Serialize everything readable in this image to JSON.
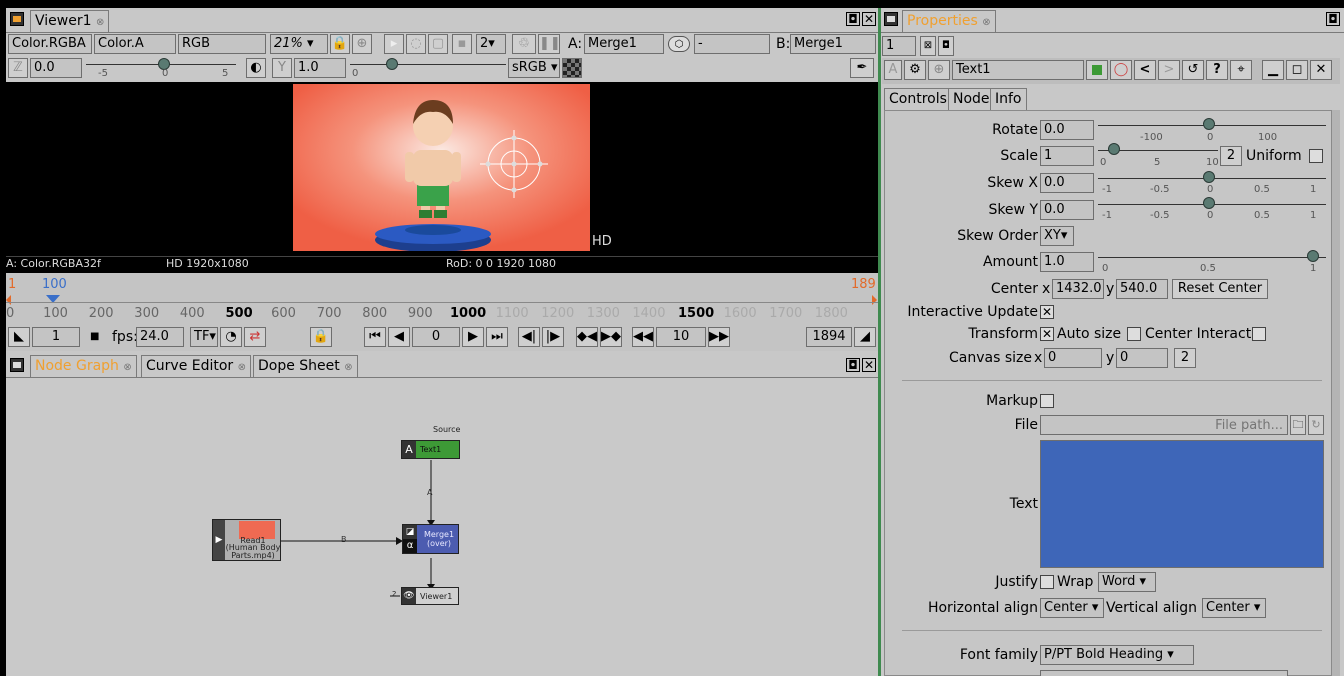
{
  "viewer": {
    "tab": "Viewer1",
    "layer": "Color.RGBA",
    "alpha": "Color.A",
    "channels": "RGB",
    "zoom": "21%",
    "proxy": "2",
    "a_label": "A:",
    "a_input": "Merge1",
    "wipe": "-",
    "b_label": "B:",
    "b_input": "Merge1",
    "gain": "0.0",
    "gamma": "1.0",
    "colorspace": "sRGB",
    "gain_ticks": [
      "-5",
      "0",
      "5"
    ],
    "gamma_ticks": [
      "0"
    ],
    "format_badge": "HD",
    "info_left": "A: Color.RGBA32f",
    "info_mid": "HD 1920x1080",
    "info_right": "RoD: 0 0 1920 1080"
  },
  "timeline": {
    "first_marker": "1",
    "current_marker": "100",
    "last_marker": "189",
    "ruler": [
      "0",
      "100",
      "200",
      "300",
      "400",
      "500",
      "600",
      "700",
      "800",
      "900",
      "1000",
      "1100",
      "1200",
      "1300",
      "1400",
      "1500",
      "1600",
      "1700",
      "1800"
    ],
    "start": "1",
    "fps_label": "fps:",
    "fps": "24.0",
    "tf": "TF",
    "frame": "0",
    "increment": "10",
    "end": "1894"
  },
  "nodegraph": {
    "tabs": [
      "Node Graph",
      "Curve Editor",
      "Dope Sheet"
    ],
    "text_node": {
      "label": "Text1",
      "source": "Source",
      "input": "A"
    },
    "read_node": {
      "label": "Read1",
      "sub": "(Human Body Parts.mp4)"
    },
    "merge_node": {
      "label": "Merge1",
      "sub": "(over)"
    },
    "viewer_node": {
      "label": "Viewer1",
      "idx": "2"
    },
    "edge_a": "A",
    "edge_b": "B"
  },
  "properties": {
    "tab": "Properties",
    "max_panels": "1",
    "node_name": "Text1",
    "subtabs": [
      "Controls",
      "Node",
      "Info"
    ],
    "rotate_label": "Rotate",
    "rotate": "0.0",
    "rotate_ticks": [
      "-100",
      "0",
      "100"
    ],
    "scale_label": "Scale",
    "scale": "1",
    "scale_ticks": [
      "0",
      "5",
      "10"
    ],
    "scale_dim": "2",
    "uniform": "Uniform",
    "skewx_label": "Skew X",
    "skewx": "0.0",
    "skewy_label": "Skew Y",
    "skewy": "0.0",
    "skew_ticks": [
      "-1",
      "-0.5",
      "0",
      "0.5",
      "1"
    ],
    "skew_order_label": "Skew Order",
    "skew_order": "XY",
    "amount_label": "Amount",
    "amount": "1.0",
    "amount_ticks": [
      "0",
      "0.5",
      "1"
    ],
    "center_label": "Center",
    "center_x_label": "x",
    "center_x": "1432.0",
    "center_y_label": "y",
    "center_y": "540.0",
    "reset_center": "Reset Center",
    "interactive_update": "Interactive Update",
    "transform": "Transform",
    "auto_size": "Auto size",
    "center_interact": "Center Interact",
    "canvas_label": "Canvas size",
    "canvas_x_label": "x",
    "canvas_x": "0",
    "canvas_y_label": "y",
    "canvas_y": "0",
    "canvas_dim": "2",
    "markup": "Markup",
    "file_label": "File",
    "file_placeholder": "File path...",
    "text_label": "Text",
    "justify": "Justify",
    "wrap": "Wrap",
    "wrap_mode": "Word",
    "halign_label": "Horizontal align",
    "halign": "Center",
    "valign_label": "Vertical align",
    "valign": "Center",
    "font_family_label": "Font family",
    "font_family": "P/PT Bold Heading"
  },
  "colors": {
    "accent": "#f0a030",
    "text_swatch": "#3e66b8",
    "merge": "#4c5cb0",
    "text_node": "#3d9a36",
    "viewport_bg": "#f06a50"
  }
}
